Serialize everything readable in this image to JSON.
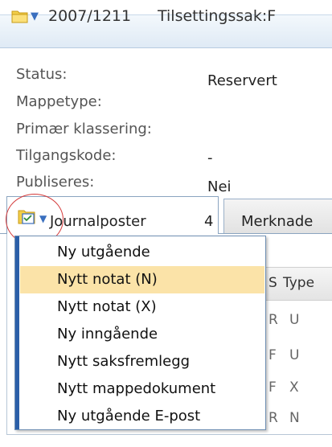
{
  "header": {
    "case_number": "2007/1211",
    "case_title": "Tilsettingssak:F"
  },
  "properties": [
    {
      "label": "Status:",
      "value": "Reservert"
    },
    {
      "label": "Mappetype:",
      "value": ""
    },
    {
      "label": "Primær klassering:",
      "value": ""
    },
    {
      "label": "Tilgangskode:",
      "value": "-"
    },
    {
      "label": "Publiseres:",
      "value": "Nei"
    }
  ],
  "tabs": [
    {
      "label": "Journalposter",
      "count": "4"
    },
    {
      "label": "Merknade"
    }
  ],
  "table": {
    "columns": [
      "S",
      "Type"
    ],
    "rows": [
      [
        "R",
        "U"
      ],
      [
        "F",
        "U"
      ],
      [
        "F",
        "X"
      ],
      [
        "R",
        "N"
      ]
    ]
  },
  "menu": {
    "highlighted_index": 1,
    "items": [
      "Ny utgående",
      "Nytt notat (N)",
      "Nytt notat (X)",
      "Ny inngående",
      "Nytt saksfremlegg",
      "Nytt mappedokument",
      "Ny utgående E-post"
    ]
  },
  "colors": {
    "menu_highlight": "#fbe3a8",
    "annotation_circle": "#d43a3a",
    "accent": "#2b5fa8"
  }
}
